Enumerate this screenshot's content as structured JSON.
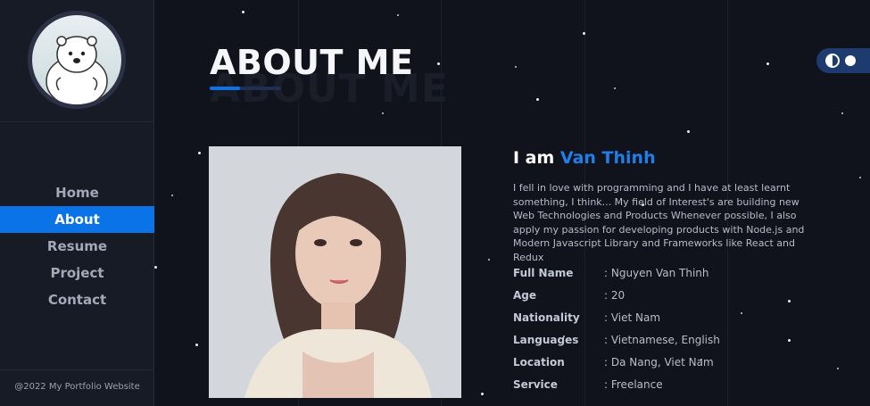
{
  "sidebar": {
    "nav": [
      {
        "label": "Home",
        "active": false
      },
      {
        "label": "About",
        "active": true
      },
      {
        "label": "Resume",
        "active": false
      },
      {
        "label": "Project",
        "active": false
      },
      {
        "label": "Contact",
        "active": false
      }
    ],
    "footer": "@2022 My Portfolio Website"
  },
  "theme_toggle": {
    "icon": "contrast-icon"
  },
  "main": {
    "title": "ABOUT ME",
    "intro_prefix": "I am ",
    "intro_name": "Van Thinh",
    "bio": "I fell in love with programming and I have at least learnt something, I think... My field of Interest's are building new Web Technologies and Products Whenever possible, I also apply my passion for developing products with Node.js and Modern Javascript Library and Frameworks like React and Redux",
    "info": [
      {
        "label": "Full Name",
        "value": ": Nguyen Van Thinh"
      },
      {
        "label": "Age",
        "value": ": 20"
      },
      {
        "label": "Nationality",
        "value": ": Viet Nam"
      },
      {
        "label": "Languages",
        "value": ": Vietnamese, English"
      },
      {
        "label": "Location",
        "value": ": Da Nang, Viet Nam"
      },
      {
        "label": "Service",
        "value": ": Freelance"
      }
    ]
  },
  "colors": {
    "accent": "#0b73e8",
    "background": "#10131c",
    "sidebar": "#171b26"
  }
}
